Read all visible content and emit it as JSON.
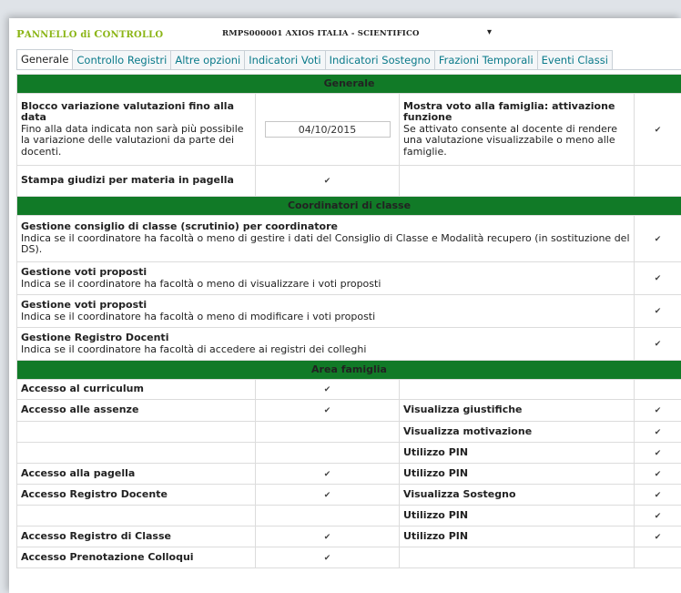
{
  "header": {
    "title_p": "P",
    "title_anello": "ANNELLO",
    "title_di": " di ",
    "title_c": "C",
    "title_ontrollo": "ONTROLLO",
    "school_select_value": "RMPS000001 AXIOS ITALIA - SCIENTIFICO",
    "select_caret": "▾"
  },
  "tabs": [
    {
      "label": "Generale"
    },
    {
      "label": "Controllo Registri"
    },
    {
      "label": "Altre opzioni"
    },
    {
      "label": "Indicatori Voti"
    },
    {
      "label": "Indicatori Sostegno"
    },
    {
      "label": "Frazioni Temporali"
    },
    {
      "label": "Eventi Classi"
    }
  ],
  "check_glyph": "✔",
  "section_generale": {
    "header": "Generale",
    "blocco_title": "Blocco variazione valutazioni fino alla data",
    "blocco_desc": "Fino alla data indicata non sarà più possibile la variazione delle valutazioni da parte dei docenti.",
    "blocco_date_value": "04/10/2015",
    "mostra_title": "Mostra voto alla famiglia: attivazione funzione",
    "mostra_desc": "Se attivato consente al docente di rendere una valutazione visualizzabile o meno alle famiglie.",
    "stampa_title": "Stampa giudizi per materia in pagella"
  },
  "section_coordinatori": {
    "header": "Coordinatori di classe",
    "rows": [
      {
        "title": "Gestione consiglio di classe (scrutinio) per coordinatore",
        "desc": "Indica se il coordinatore ha facoltà o meno di gestire i dati del Consiglio di Classe e Modalità recupero (in sostituzione del DS)."
      },
      {
        "title": "Gestione voti proposti",
        "desc": "Indica se il coordinatore ha facoltà o meno di visualizzare i voti proposti"
      },
      {
        "title": "Gestione voti proposti",
        "desc": "Indica se il coordinatore ha facoltà o meno di modificare i voti proposti"
      },
      {
        "title": "Gestione Registro Docenti",
        "desc": "Indica se il coordinatore ha facoltà di accedere ai registri dei colleghi"
      }
    ]
  },
  "section_famiglia": {
    "header": "Area famiglia",
    "rows": [
      {
        "left": "Accesso al curriculum",
        "right": ""
      },
      {
        "left": "Accesso alle assenze",
        "right": "Visualizza giustifiche"
      },
      {
        "left": "",
        "right": "Visualizza motivazione"
      },
      {
        "left": "",
        "right": "Utilizzo PIN"
      },
      {
        "left": "Accesso alla pagella",
        "right": "Utilizzo PIN"
      },
      {
        "left": "Accesso Registro Docente",
        "right": "Visualizza Sostegno"
      },
      {
        "left": "",
        "right": "Utilizzo PIN"
      },
      {
        "left": "Accesso Registro di Classe",
        "right": "Utilizzo PIN"
      },
      {
        "left": "Accesso Prenotazione Colloqui",
        "right": ""
      }
    ]
  }
}
